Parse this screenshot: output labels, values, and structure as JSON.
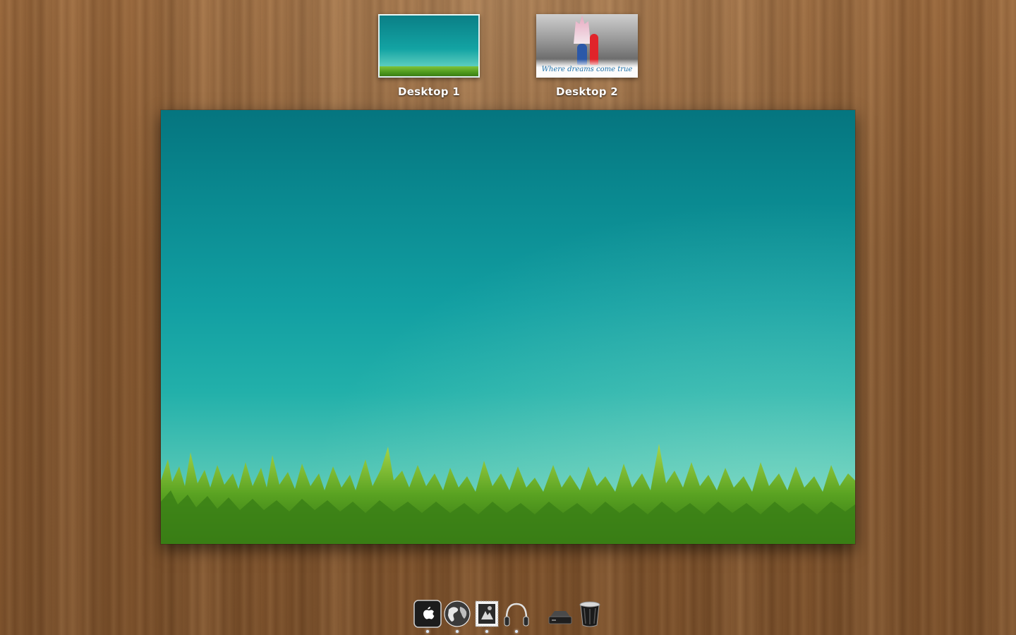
{
  "spaces": [
    {
      "label": "Desktop 1",
      "active": true,
      "wallpaper": "teal-sky-grass"
    },
    {
      "label": "Desktop 2",
      "active": false,
      "wallpaper": "castle-proposal-photo",
      "caption": "Where dreams come true"
    }
  ],
  "main_preview": {
    "wallpaper": "teal-sky-grass",
    "colors": {
      "sky_top": "#05757f",
      "sky_bottom": "#73d3c0",
      "grass": "#4f9a1e"
    }
  },
  "dock": {
    "items": [
      {
        "name": "finder-icon",
        "running": true
      },
      {
        "name": "globe-icon",
        "running": true
      },
      {
        "name": "mail-stamp-icon",
        "running": true
      },
      {
        "name": "headphones-icon",
        "running": true
      },
      {
        "name": "downloads-stack-icon",
        "running": false
      },
      {
        "name": "trash-icon",
        "running": false
      }
    ]
  },
  "background": {
    "texture": "wood",
    "color": "#8a5d35"
  }
}
